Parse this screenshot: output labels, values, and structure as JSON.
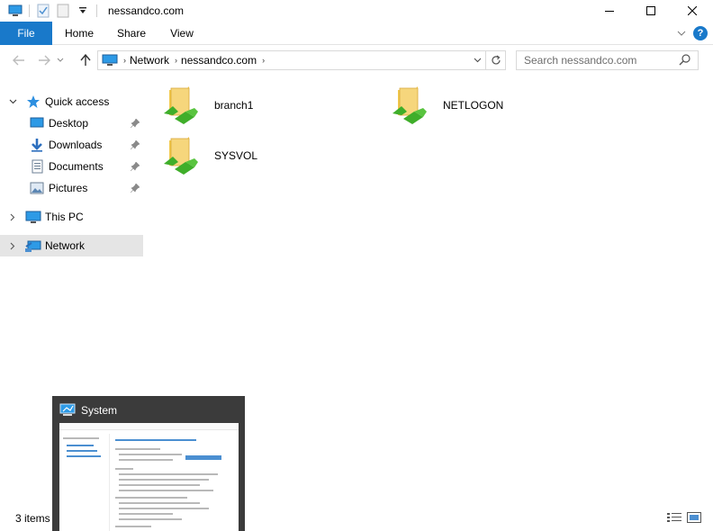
{
  "window": {
    "title": "nessandco.com"
  },
  "ribbon": {
    "tabs": [
      {
        "label": "File"
      },
      {
        "label": "Home"
      },
      {
        "label": "Share"
      },
      {
        "label": "View"
      }
    ],
    "help_label": "?"
  },
  "address": {
    "crumbs": [
      "Network",
      "nessandco.com"
    ],
    "search_placeholder": "Search nessandco.com"
  },
  "navpane": {
    "quick_access": "Quick access",
    "quick_items": [
      {
        "label": "Desktop",
        "icon": "desktop-icon",
        "pinned": true
      },
      {
        "label": "Downloads",
        "icon": "download-icon",
        "pinned": true
      },
      {
        "label": "Documents",
        "icon": "documents-icon",
        "pinned": true
      },
      {
        "label": "Pictures",
        "icon": "pictures-icon",
        "pinned": true
      }
    ],
    "this_pc": "This PC",
    "network": "Network"
  },
  "content": {
    "folders": [
      {
        "name": "branch1",
        "icon": "shared-folder-icon"
      },
      {
        "name": "NETLOGON",
        "icon": "shared-folder-icon"
      },
      {
        "name": "SYSVOL",
        "icon": "shared-folder-icon"
      }
    ]
  },
  "status": {
    "item_count": "3 items"
  },
  "taskbar_preview": {
    "title": "System"
  },
  "colors": {
    "accent": "#1979ca",
    "selection": "#e5e5e5",
    "folder": "#f6d67c",
    "share_green": "#3fae2a"
  }
}
